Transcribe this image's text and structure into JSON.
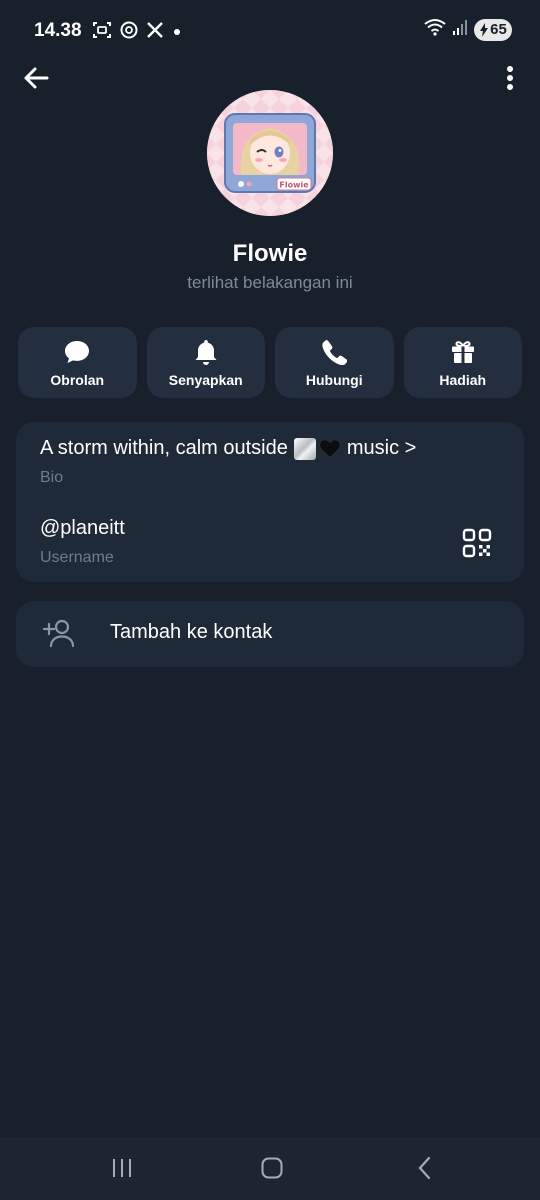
{
  "status_bar": {
    "time": "14.38",
    "battery_level": "65",
    "left_icons": [
      "screenshot-icon",
      "threads-icon",
      "x-icon",
      "dot-icon"
    ],
    "right_icons": [
      "wifi-icon",
      "signal-icon",
      "battery-charging-icon"
    ]
  },
  "header": {
    "back_icon": "arrow-left-icon",
    "more_icon": "more-vertical-icon"
  },
  "profile": {
    "avatar_caption": "Flowie",
    "name": "Flowie",
    "status": "terlihat belakangan ini"
  },
  "actions": [
    {
      "label": "Obrolan",
      "icon": "chat-bubble-icon"
    },
    {
      "label": "Senyapkan",
      "icon": "bell-icon"
    },
    {
      "label": "Hubungi",
      "icon": "phone-icon"
    },
    {
      "label": "Hadiah",
      "icon": "gift-icon"
    }
  ],
  "info": {
    "bio_before": "A storm within, calm outside",
    "bio_after": "music >",
    "bio_label": "Bio",
    "username": "@planeitt",
    "username_label": "Username"
  },
  "add_contact": {
    "label": "Tambah ke kontak",
    "icon": "add-person-icon"
  },
  "nav_bar": {
    "icons": [
      "recent-apps-icon",
      "home-icon",
      "back-chevron-icon"
    ]
  },
  "colors": {
    "background": "#17202b",
    "card": "#1f2a38",
    "button": "#232f3e",
    "secondary_text": "#7d8a98",
    "avatar_pink": "#f5cdd8"
  }
}
